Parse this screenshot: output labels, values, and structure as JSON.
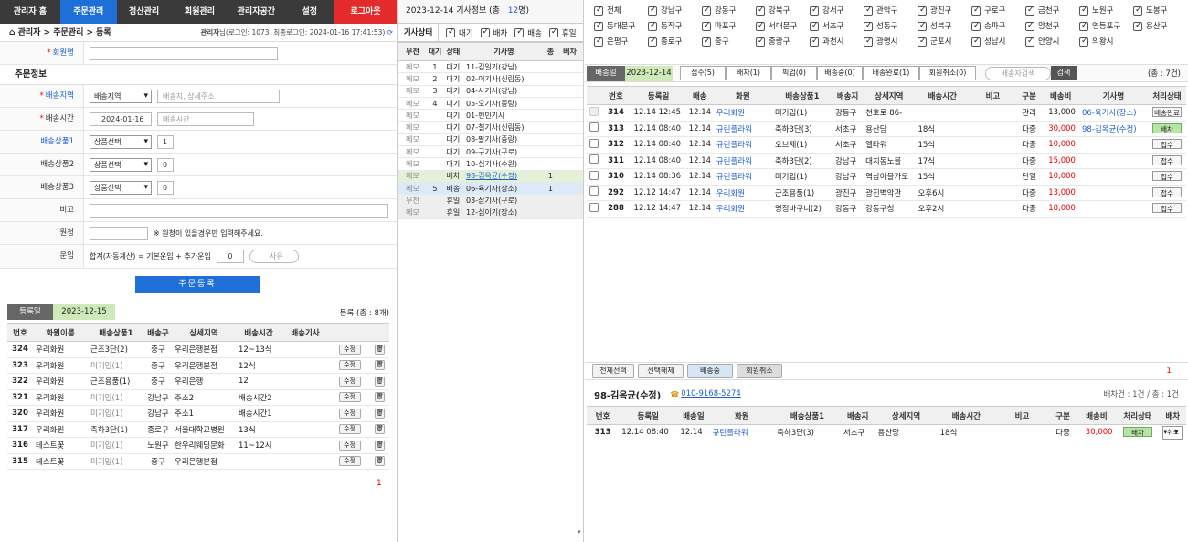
{
  "nav": [
    "관리자 홈",
    "주문관리",
    "정산관리",
    "회원관리",
    "관리자공간",
    "설정",
    "로그아웃"
  ],
  "crumb": {
    "path": "관리자 > 주문관리 > 등록",
    "info_label": "관리자",
    "info_rest": "님(로그인: 1073, 최종로그인: 2024-01-16 17:41:53)"
  },
  "form": {
    "member_label": "회원명",
    "section": "주문정보",
    "area_label": "배송지역",
    "area_select": "배송지역",
    "area_placeholder": "배송지, 상세주소",
    "time_label": "배송시간",
    "date": "2024-01-16",
    "time_placeholder": "배송시간",
    "p1_label": "배송상품1",
    "p1_select": "상품선택",
    "p1_qty": "1",
    "p2_label": "배송상품2",
    "p2_select": "상품선택",
    "p2_qty": "0",
    "p3_label": "배송상품3",
    "p3_select": "상품선택",
    "p3_qty": "0",
    "note_label": "비고",
    "src_label": "원청",
    "src_hint": "※ 원청이 있을경우만 입력해주세요.",
    "fee_label": "운임",
    "fee_text": "합계(자동계산) = 기본운임 + 추가운임",
    "fee_val": "0",
    "fee_reason": "사유",
    "submit": "주문등록"
  },
  "leftlist": {
    "date_label": "등록일",
    "date": "2023-12-15",
    "count": "등록 (총 : 8개)",
    "headers": [
      "번호",
      "화원이름",
      "배송상품1",
      "배송구",
      "상세지역",
      "배송시간",
      "배송기사"
    ],
    "edit": "수정",
    "rows": [
      [
        "324",
        "우리화원",
        "근조3단(2)",
        "중구",
        "우리은행본점",
        "12~13식"
      ],
      [
        "323",
        "우리화원",
        "미기입(1)",
        "중구",
        "우리은행본점",
        "12식"
      ],
      [
        "322",
        "우리화원",
        "근조용품(1)",
        "중구",
        "우리은행",
        "12"
      ],
      [
        "321",
        "우리화원",
        "미기입(1)",
        "강남구",
        "주소2",
        "배송시간2"
      ],
      [
        "320",
        "우리화원",
        "미기입(1)",
        "강남구",
        "주소1",
        "배송시간1"
      ],
      [
        "317",
        "우리화원",
        "축하3단(1)",
        "종로구",
        "서울대학교병원",
        "13식"
      ],
      [
        "316",
        "테스트꽃",
        "미기입(1)",
        "노원구",
        "한우리웨딩문화",
        "11~12시"
      ],
      [
        "315",
        "테스트꽃",
        "미기입(1)",
        "중구",
        "우리은행본점",
        ""
      ]
    ],
    "page": "1"
  },
  "mid": {
    "date": "2023-12-14",
    "title": "기사정보 (총 : ",
    "total": "12",
    "title_end": "명)",
    "status_label": "기사상태",
    "filters": [
      "대기",
      "배차",
      "배송",
      "휴일"
    ],
    "headers": [
      "무전",
      "대기",
      "상태",
      "기사명",
      "총",
      "배차"
    ],
    "rows": [
      [
        "메모",
        "1",
        "대기",
        "11-김일기(강남)",
        "",
        ""
      ],
      [
        "메모",
        "2",
        "대기",
        "02-이기사(신림동)",
        "",
        ""
      ],
      [
        "메모",
        "3",
        "대기",
        "04-사기사(강남)",
        "",
        ""
      ],
      [
        "메모",
        "4",
        "대기",
        "05-오기사(중랑)",
        "",
        ""
      ],
      [
        "메모",
        "",
        "대기",
        "01-현민기사",
        "",
        ""
      ],
      [
        "메모",
        "",
        "대기",
        "07-칠기사(신림동)",
        "",
        ""
      ],
      [
        "메모",
        "",
        "대기",
        "08-팔기사(중랑)",
        "",
        ""
      ],
      [
        "메모",
        "",
        "대기",
        "09-구기사(구로)",
        "",
        ""
      ],
      [
        "메모",
        "",
        "대기",
        "10-십기사(수원)",
        "",
        ""
      ],
      [
        "메모",
        "",
        "배차",
        "98-김옥균(수정)",
        "1",
        ""
      ],
      [
        "메모",
        "5",
        "배송",
        "06-육기사(장소)",
        "1",
        ""
      ],
      [
        "무전",
        "",
        "휴일",
        "03-삼기사(구로)",
        "",
        ""
      ],
      [
        "메모",
        "",
        "휴일",
        "12-십이기(장소)",
        "",
        ""
      ]
    ]
  },
  "regions": [
    "전체",
    "강남구",
    "강동구",
    "강북구",
    "강서구",
    "관악구",
    "광진구",
    "구로구",
    "금천구",
    "노원구",
    "도봉구",
    "동대문구",
    "동작구",
    "마포구",
    "서대문구",
    "서초구",
    "성동구",
    "성북구",
    "송파구",
    "양천구",
    "영등포구",
    "용산구",
    "은평구",
    "종로구",
    "중구",
    "중랑구",
    "과천시",
    "광명시",
    "군포시",
    "성남시",
    "안양시",
    "의왕시"
  ],
  "rtabs": {
    "date_label": "배송일",
    "date": "2023-12-14",
    "tabs": [
      "접수(5)",
      "배차(1)",
      "픽업(0)",
      "배송중(0)",
      "배송완료(1)",
      "회원취소(0)"
    ],
    "search_placeholder": "배송자검색",
    "search_btn": "검색",
    "count": "(총 : 7건)"
  },
  "orders": {
    "headers": [
      "번호",
      "등록일",
      "배송",
      "화원",
      "배송상품1",
      "배송지",
      "상세지역",
      "배송시간",
      "비고",
      "구분",
      "배송비",
      "기사명",
      "처리상태"
    ],
    "rows": [
      [
        "314",
        "12.14 12:45",
        "12.14",
        "우리화원",
        "미기입(1)",
        "강동구",
        "천호로 86-",
        "",
        "",
        "관리",
        "13,000",
        "06-육기사(장소)",
        "배송완료"
      ],
      [
        "313",
        "12.14 08:40",
        "12.14",
        "규린플라워",
        "축하3단(3)",
        "서초구",
        "용산당",
        "18식",
        "",
        "다중",
        "30,000",
        "98-김옥균(수정)",
        "배차"
      ],
      [
        "312",
        "12.14 08:40",
        "12.14",
        "규린플라워",
        "오브제(1)",
        "서초구",
        "엘타워",
        "15식",
        "",
        "다중",
        "10,000",
        "",
        "접수"
      ],
      [
        "311",
        "12.14 08:40",
        "12.14",
        "규린플라워",
        "축하3단(2)",
        "강남구",
        "대치동노블",
        "17식",
        "",
        "다중",
        "15,000",
        "",
        "접수"
      ],
      [
        "310",
        "12.14 08:36",
        "12.14",
        "규린플라워",
        "미기입(1)",
        "강남구",
        "역삼아블가모",
        "15식",
        "",
        "단일",
        "10,000",
        "",
        "접수"
      ],
      [
        "292",
        "12.12 14:47",
        "12.14",
        "우리화원",
        "근조용품(1)",
        "광진구",
        "광진벽악관",
        "오후6시",
        "",
        "다중",
        "13,000",
        "",
        "접수"
      ],
      [
        "288",
        "12.12 14:47",
        "12.14",
        "우리화원",
        "영정바구니(2)",
        "강동구",
        "강동구청",
        "오후2시",
        "",
        "다중",
        "18,000",
        "",
        "접수"
      ]
    ]
  },
  "actions": [
    "전체선택",
    "선택해제",
    "배송중",
    "회원취소"
  ],
  "page2": "1",
  "driver": {
    "name": "98-김옥균(수정)",
    "phone": "010-9168-5274",
    "counts": "배차건 : 1건 / 총 : 1건",
    "headers": [
      "번호",
      "등록일",
      "배송일",
      "화원",
      "배송상품1",
      "배송지",
      "상세지역",
      "배송시간",
      "비고",
      "구분",
      "배송비",
      "처리상태",
      "배차"
    ],
    "row": [
      "313",
      "12.14 08:40",
      "12.14",
      "규린플라워",
      "축하3단(3)",
      "서초구",
      "용산당",
      "18식",
      "",
      "다중",
      "30,000",
      "배차",
      "▾취소"
    ]
  }
}
